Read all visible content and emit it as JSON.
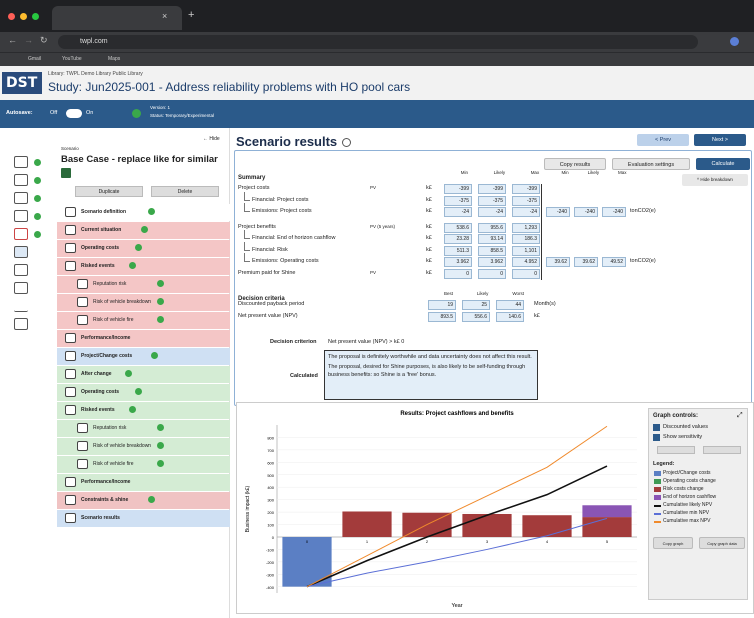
{
  "browser": {
    "tab_title": "",
    "url": "twpl.com",
    "bookmarks": [
      "Gmail",
      "YouTube",
      "Maps"
    ]
  },
  "app": {
    "library": "Library: TWPL Demo Library Public Library",
    "study_title": "Study: Jun2025-001 - Address reliability problems with HO pool cars",
    "logo": "DST",
    "version": "Version: 1",
    "status": "Status: Temporary/Experimental",
    "autosave": "Autosave:",
    "off": "Off",
    "on": "On"
  },
  "nav": {
    "hide": "← Hide",
    "scenario_label": "Scenario",
    "scenario_name": "Base Case - replace like for similar",
    "duplicate": "Duplicate",
    "delete": "Delete",
    "items": [
      {
        "label": "Scenario definition",
        "sub": false,
        "bg": "#ffffff"
      },
      {
        "label": "Current situation",
        "sub": false,
        "bg": "#f4c6c6"
      },
      {
        "label": "Operating costs",
        "sub": false,
        "bg": "#f4c6c6"
      },
      {
        "label": "Risked events",
        "sub": false,
        "bg": "#f4c6c6"
      },
      {
        "label": "Reputation risk",
        "sub": true,
        "bg": "#f4c6c6"
      },
      {
        "label": "Risk of vehicle breakdown",
        "sub": true,
        "bg": "#f4c6c6"
      },
      {
        "label": "Risk of vehicle fire",
        "sub": true,
        "bg": "#f4c6c6"
      },
      {
        "label": "Performance/Income",
        "sub": false,
        "bg": "#f4c6c6"
      },
      {
        "label": "Project/Change costs",
        "sub": false,
        "bg": "#cfe0f3"
      },
      {
        "label": "After change",
        "sub": false,
        "bg": "#d4ecd4"
      },
      {
        "label": "Operating costs",
        "sub": false,
        "bg": "#d4ecd4"
      },
      {
        "label": "Risked events",
        "sub": false,
        "bg": "#d4ecd4"
      },
      {
        "label": "Reputation risk",
        "sub": true,
        "bg": "#d4ecd4"
      },
      {
        "label": "Risk of vehicle breakdown",
        "sub": true,
        "bg": "#d4ecd4"
      },
      {
        "label": "Risk of vehicle fire",
        "sub": true,
        "bg": "#d4ecd4"
      },
      {
        "label": "Performance/Income",
        "sub": false,
        "bg": "#d4ecd4"
      },
      {
        "label": "Constraints & shine",
        "sub": false,
        "bg": "#f0c3c3"
      },
      {
        "label": "Scenario results",
        "sub": false,
        "bg": "#cfe0f3"
      }
    ]
  },
  "main": {
    "title": "Scenario results",
    "prev": "< Prev",
    "next": "Next >",
    "copy_results": "Copy results",
    "eval_settings": "Evaluation settings",
    "calculate": "Calculate",
    "hide_breakdown": "^ Hide breakdown",
    "summary": "Summary",
    "headers": [
      "Min",
      "Likely",
      "Max"
    ],
    "headers2": [
      "Min",
      "Likely",
      "Max"
    ],
    "rows": [
      {
        "label": "Project costs",
        "tag": "PV",
        "unit": "k£",
        "min": "-399",
        "likely": "-399",
        "max": "-399",
        "e": []
      },
      {
        "label": "Financial: Project costs",
        "tag": "",
        "unit": "k£",
        "min": "-375",
        "likely": "-375",
        "max": "-375",
        "e": []
      },
      {
        "label": "Emissions: Project costs",
        "tag": "",
        "unit": "k£",
        "min": "-24",
        "likely": "-24",
        "max": "-24",
        "e": [
          "-240",
          "-240",
          "-240"
        ],
        "eunit": "tonCO2(e)"
      },
      {
        "label": "Project benefits",
        "tag": "PV (5 years)",
        "unit": "k£",
        "min": "538.6",
        "likely": "955.6",
        "max": "1,293",
        "e": []
      },
      {
        "label": "Financial: End of horizon cashflow",
        "tag": "",
        "unit": "k£",
        "min": "23.28",
        "likely": "93.14",
        "max": "186.3",
        "e": []
      },
      {
        "label": "Financial: Risk",
        "tag": "",
        "unit": "k£",
        "min": "511.3",
        "likely": "858.5",
        "max": "1,101",
        "e": []
      },
      {
        "label": "Emissions: Operating costs",
        "tag": "",
        "unit": "k£",
        "min": "3.962",
        "likely": "3.962",
        "max": "4.952",
        "e": [
          "39.62",
          "39.62",
          "49.52"
        ],
        "eunit": "tonCO2(e)"
      },
      {
        "label": "Premium paid for Shine",
        "tag": "PV",
        "unit": "k£",
        "min": "0",
        "likely": "0",
        "max": "0",
        "e": []
      }
    ],
    "decision_title": "Decision criteria",
    "dheaders": [
      "Best",
      "Likely",
      "Worst"
    ],
    "drows": [
      {
        "label": "Discounted payback period",
        "v": [
          "19",
          "25",
          "44"
        ],
        "unit": "Month(s)"
      },
      {
        "label": "Net present value (NPV)",
        "v": [
          "893.5",
          "556.6",
          "140.6"
        ],
        "unit": "k£"
      }
    ],
    "criterion_label": "Decision criterion",
    "criterion_value": "Net present value (NPV) > k£ 0",
    "calculated_label": "Calculated",
    "calc_text1": "The proposal is definitely worthwhile and data uncertainty does not affect this result.",
    "calc_text2": "The proposal, desired for Shine purposes, is also likely to be self-funding through business benefits: so Shine is a 'free' bonus."
  },
  "controls": {
    "title": "Graph controls:",
    "discounted": "Discounted values",
    "sensitivity": "Show sensitivity",
    "legend_title": "Legend:",
    "copy_graph": "Copy graph",
    "copy_graph_data": "Copy graph data",
    "legend": [
      {
        "label": "Project/Change costs",
        "color": "#5b7fc4",
        "type": "box"
      },
      {
        "label": "Operating costs change",
        "color": "#3f9a55",
        "type": "box"
      },
      {
        "label": "Risk costs change",
        "color": "#a33b3b",
        "type": "box"
      },
      {
        "label": "End of horizon cashflow",
        "color": "#8a55b5",
        "type": "box"
      },
      {
        "label": "Cumulative likely NPV",
        "color": "#111111",
        "type": "line"
      },
      {
        "label": "Cumulative min NPV",
        "color": "#5b6fd6",
        "type": "line"
      },
      {
        "label": "Cumulative max NPV",
        "color": "#f08a2c",
        "type": "line"
      }
    ]
  },
  "chart_data": {
    "type": "bar",
    "title": "Results: Project cashflows and benefits",
    "xlabel": "Year",
    "ylabel": "Business impact (k£)",
    "ylim": [
      -450,
      900
    ],
    "categories": [
      "0",
      "1",
      "2",
      "3",
      "4",
      "5"
    ],
    "yticks": [
      "800",
      "700",
      "600",
      "500",
      "400",
      "300",
      "200",
      "100",
      "0",
      "-100",
      "-200",
      "-300",
      "-400"
    ],
    "series": [
      {
        "name": "Project/Change costs",
        "values": [
          -399,
          0,
          0,
          0,
          0,
          0
        ]
      },
      {
        "name": "Risk costs change",
        "values": [
          0,
          205,
          195,
          185,
          175,
          160
        ]
      },
      {
        "name": "End of horizon cashflow",
        "values": [
          0,
          0,
          0,
          0,
          0,
          95
        ]
      },
      {
        "name": "Cumulative likely NPV",
        "values": [
          -399,
          -190,
          0,
          175,
          340,
          570
        ]
      },
      {
        "name": "Cumulative min NPV",
        "values": [
          -399,
          -290,
          -200,
          -100,
          10,
          150
        ]
      },
      {
        "name": "Cumulative max NPV",
        "values": [
          -399,
          -150,
          100,
          330,
          560,
          890
        ]
      }
    ]
  }
}
